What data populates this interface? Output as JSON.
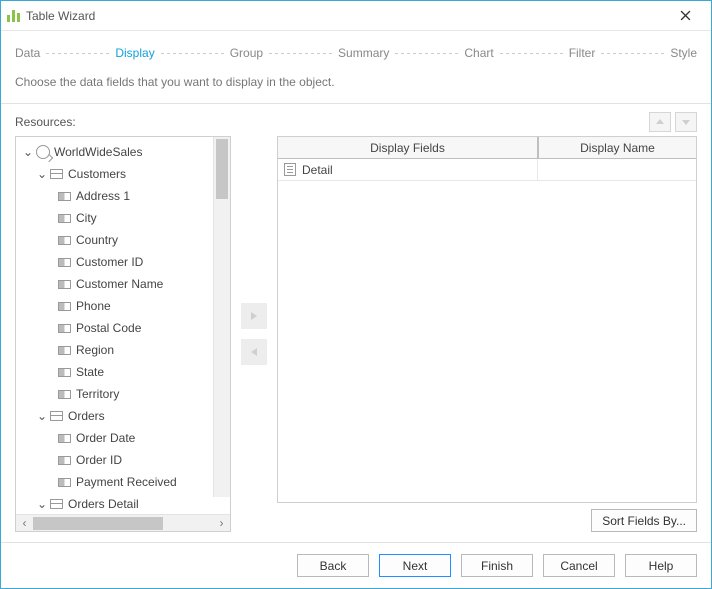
{
  "window": {
    "title": "Table Wizard"
  },
  "steps": {
    "data": "Data",
    "display": "Display",
    "group": "Group",
    "summary": "Summary",
    "chart": "Chart",
    "filter": "Filter",
    "style": "Style",
    "active": "display"
  },
  "instruction": "Choose the data fields that you want to display in the object.",
  "resources_label": "Resources:",
  "tree": {
    "root": "WorldWideSales",
    "groups": [
      {
        "name": "Customers",
        "fields": [
          "Address 1",
          "City",
          "Country",
          "Customer ID",
          "Customer Name",
          "Phone",
          "Postal Code",
          "Region",
          "State",
          "Territory"
        ]
      },
      {
        "name": "Orders",
        "fields": [
          "Order Date",
          "Order ID",
          "Payment Received"
        ]
      },
      {
        "name": "Orders Detail",
        "fields": []
      }
    ]
  },
  "fields_table": {
    "col_display_fields": "Display Fields",
    "col_display_name": "Display Name",
    "rows": [
      {
        "field": "Detail",
        "name": ""
      }
    ]
  },
  "buttons": {
    "sort_by": "Sort Fields By...",
    "back": "Back",
    "next": "Next",
    "finish": "Finish",
    "cancel": "Cancel",
    "help": "Help"
  }
}
